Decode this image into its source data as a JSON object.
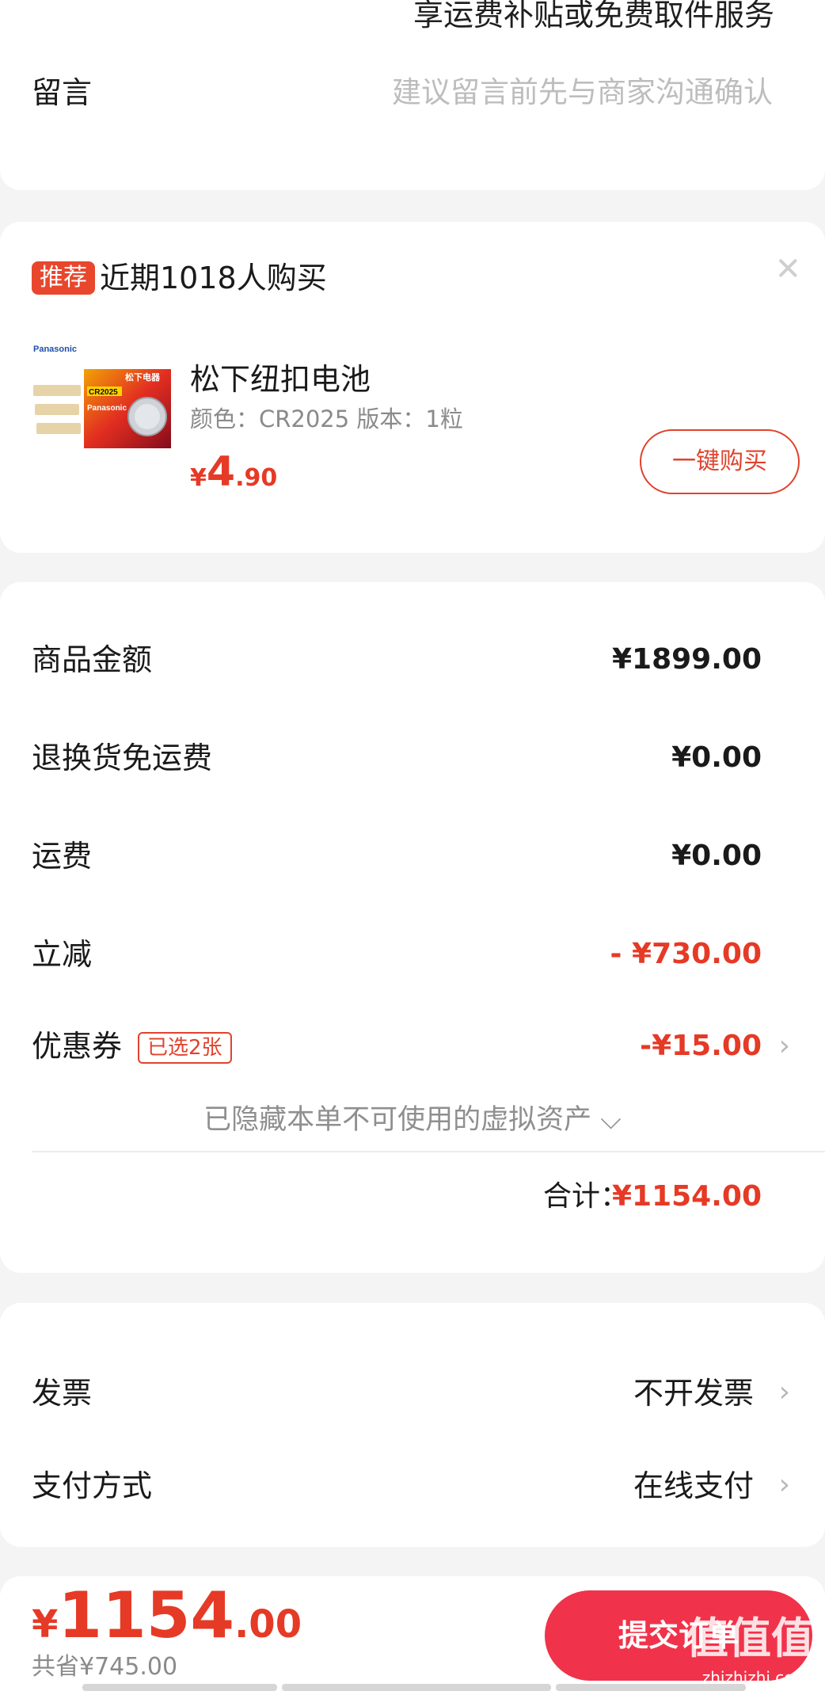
{
  "top": {
    "shipping_note": "享运费补贴或免费取件服务",
    "message_label": "留言",
    "message_placeholder": "建议留言前先与商家沟通确认"
  },
  "recommend": {
    "tag": "推荐",
    "title": "近期1018人购买",
    "close_icon": "close-icon",
    "product": {
      "name": "松下纽扣电池",
      "spec": "颜色：CR2025   版本：1粒",
      "price_currency": "¥",
      "price_int": "4",
      "price_dec": ".90",
      "image_brand": "Panasonic",
      "image_label_cn": "松下电器",
      "image_model": "CR2025",
      "buy_label": "一键购买"
    }
  },
  "amounts": {
    "goods_label": "商品金额",
    "goods_value": "¥1899.00",
    "return_label": "退换货免运费",
    "return_value": "¥0.00",
    "shipping_label": "运费",
    "shipping_value": "¥0.00",
    "discount_label": "立减",
    "discount_value": "- ¥730.00",
    "coupon_label": "优惠券",
    "coupon_badge": "已选2张",
    "coupon_value": "-¥15.00",
    "hidden_assets": "已隐藏本单不可使用的虚拟资产 ⌵",
    "total_label": "合计：",
    "total_value": "¥1154.00"
  },
  "invoice": {
    "invoice_label": "发票",
    "invoice_value": "不开发票",
    "payment_label": "支付方式",
    "payment_value": "在线支付"
  },
  "bottom": {
    "currency": "¥",
    "total_int": "1154",
    "total_dec": ".00",
    "saved": "共省¥745.00",
    "submit": "提交订单",
    "watermark": "值值值",
    "watermark_sub": "zhizhizhi.com"
  },
  "colors": {
    "accent_red": "#e53a26",
    "submit_red": "#f0334a",
    "tag_red": "#e8472d"
  }
}
